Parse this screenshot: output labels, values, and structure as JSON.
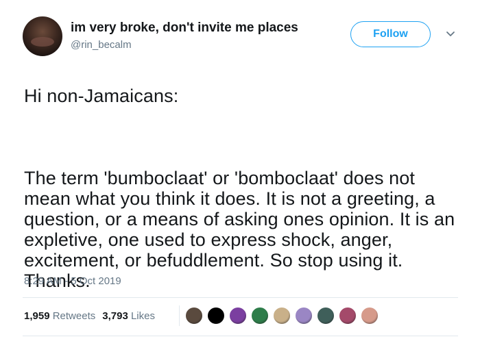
{
  "user": {
    "display_name": "im very broke, don't invite me places",
    "handle": "@rin_becalm"
  },
  "actions": {
    "follow_label": "Follow",
    "menu_icon": "chevron-down-icon"
  },
  "tweet": {
    "line1": "Hi non-Jamaicans:",
    "line2": "The term 'bumboclaat' or 'bomboclaat' does not mean what you think it does. It is not a greeting, a question, or a means of asking ones opinion. It is an expletive, one used to express shock, anger, excitement, or befuddlement. So stop using it. Thanks.",
    "timestamp": "8:29 AM - 5 Oct 2019"
  },
  "stats": {
    "retweets_count": "1,959",
    "retweets_label": "Retweets",
    "likes_count": "3,793",
    "likes_label": "Likes"
  },
  "likers": {
    "colors": [
      "#5a4a3e",
      "#000000",
      "#7b3fa0",
      "#2e7d4a",
      "#c9b089",
      "#9a86c4",
      "#3f5f5a",
      "#a44a6a",
      "#d69a8a"
    ]
  },
  "colors": {
    "accent": "#1da1f2",
    "text": "#14171a",
    "muted": "#657786"
  }
}
